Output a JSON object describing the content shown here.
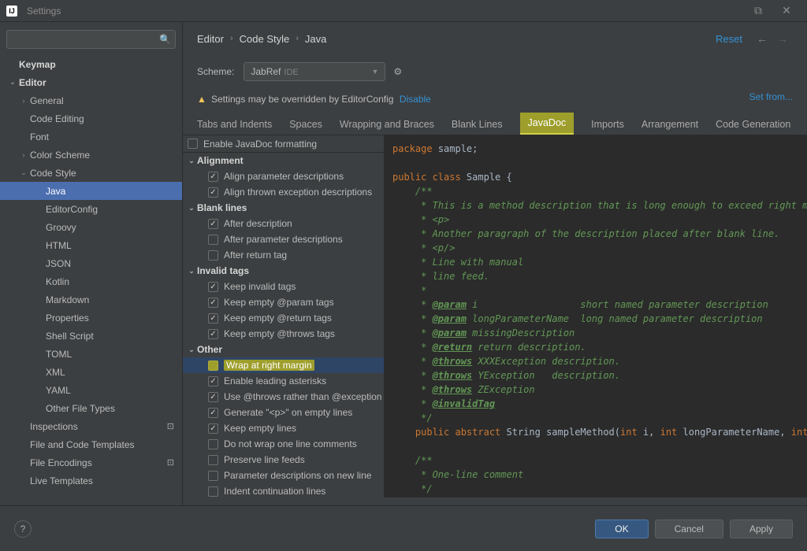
{
  "window": {
    "title": "Settings"
  },
  "breadcrumb": [
    "Editor",
    "Code Style",
    "Java"
  ],
  "topLinks": {
    "reset": "Reset",
    "setFrom": "Set from..."
  },
  "scheme": {
    "label": "Scheme:",
    "value": "JabRef",
    "scope": "IDE"
  },
  "warning": {
    "text": "Settings may be overridden by EditorConfig",
    "action": "Disable"
  },
  "tabs": [
    "Tabs and Indents",
    "Spaces",
    "Wrapping and Braces",
    "Blank Lines",
    "JavaDoc",
    "Imports",
    "Arrangement",
    "Code Generation"
  ],
  "activeTab": "JavaDoc",
  "sidebar": {
    "items": [
      {
        "label": "Keymap",
        "depth": 0,
        "bold": true
      },
      {
        "label": "Editor",
        "depth": 0,
        "bold": true,
        "arrow": "v"
      },
      {
        "label": "General",
        "depth": 1,
        "arrow": ">"
      },
      {
        "label": "Code Editing",
        "depth": 1
      },
      {
        "label": "Font",
        "depth": 1
      },
      {
        "label": "Color Scheme",
        "depth": 1,
        "arrow": ">"
      },
      {
        "label": "Code Style",
        "depth": 1,
        "arrow": "v"
      },
      {
        "label": "Java",
        "depth": 2,
        "selected": true
      },
      {
        "label": "EditorConfig",
        "depth": 2
      },
      {
        "label": "Groovy",
        "depth": 2
      },
      {
        "label": "HTML",
        "depth": 2
      },
      {
        "label": "JSON",
        "depth": 2
      },
      {
        "label": "Kotlin",
        "depth": 2
      },
      {
        "label": "Markdown",
        "depth": 2
      },
      {
        "label": "Properties",
        "depth": 2
      },
      {
        "label": "Shell Script",
        "depth": 2
      },
      {
        "label": "TOML",
        "depth": 2
      },
      {
        "label": "XML",
        "depth": 2
      },
      {
        "label": "YAML",
        "depth": 2
      },
      {
        "label": "Other File Types",
        "depth": 2
      },
      {
        "label": "Inspections",
        "depth": 1,
        "gear": true
      },
      {
        "label": "File and Code Templates",
        "depth": 1
      },
      {
        "label": "File Encodings",
        "depth": 1,
        "gear": true
      },
      {
        "label": "Live Templates",
        "depth": 1
      }
    ]
  },
  "topOption": {
    "label": "Enable JavaDoc formatting",
    "checked": true
  },
  "groups": [
    {
      "name": "Alignment",
      "items": [
        {
          "label": "Align parameter descriptions",
          "checked": true
        },
        {
          "label": "Align thrown exception descriptions",
          "checked": true
        }
      ]
    },
    {
      "name": "Blank lines",
      "items": [
        {
          "label": "After description",
          "checked": true
        },
        {
          "label": "After parameter descriptions",
          "checked": false
        },
        {
          "label": "After return tag",
          "checked": false
        }
      ]
    },
    {
      "name": "Invalid tags",
      "items": [
        {
          "label": "Keep invalid tags",
          "checked": true
        },
        {
          "label": "Keep empty @param tags",
          "checked": true
        },
        {
          "label": "Keep empty @return tags",
          "checked": true
        },
        {
          "label": "Keep empty @throws tags",
          "checked": true
        }
      ]
    },
    {
      "name": "Other",
      "items": [
        {
          "label": "Wrap at right margin",
          "checked": false,
          "highlight": true
        },
        {
          "label": "Enable leading asterisks",
          "checked": true
        },
        {
          "label": "Use @throws rather than @exception",
          "checked": true
        },
        {
          "label": "Generate \"<p>\" on empty lines",
          "checked": true
        },
        {
          "label": "Keep empty lines",
          "checked": true
        },
        {
          "label": "Do not wrap one line comments",
          "checked": false
        },
        {
          "label": "Preserve line feeds",
          "checked": false
        },
        {
          "label": "Parameter descriptions on new line",
          "checked": false
        },
        {
          "label": "Indent continuation lines",
          "checked": false
        }
      ]
    }
  ],
  "buttons": {
    "ok": "OK",
    "cancel": "Cancel",
    "apply": "Apply"
  }
}
